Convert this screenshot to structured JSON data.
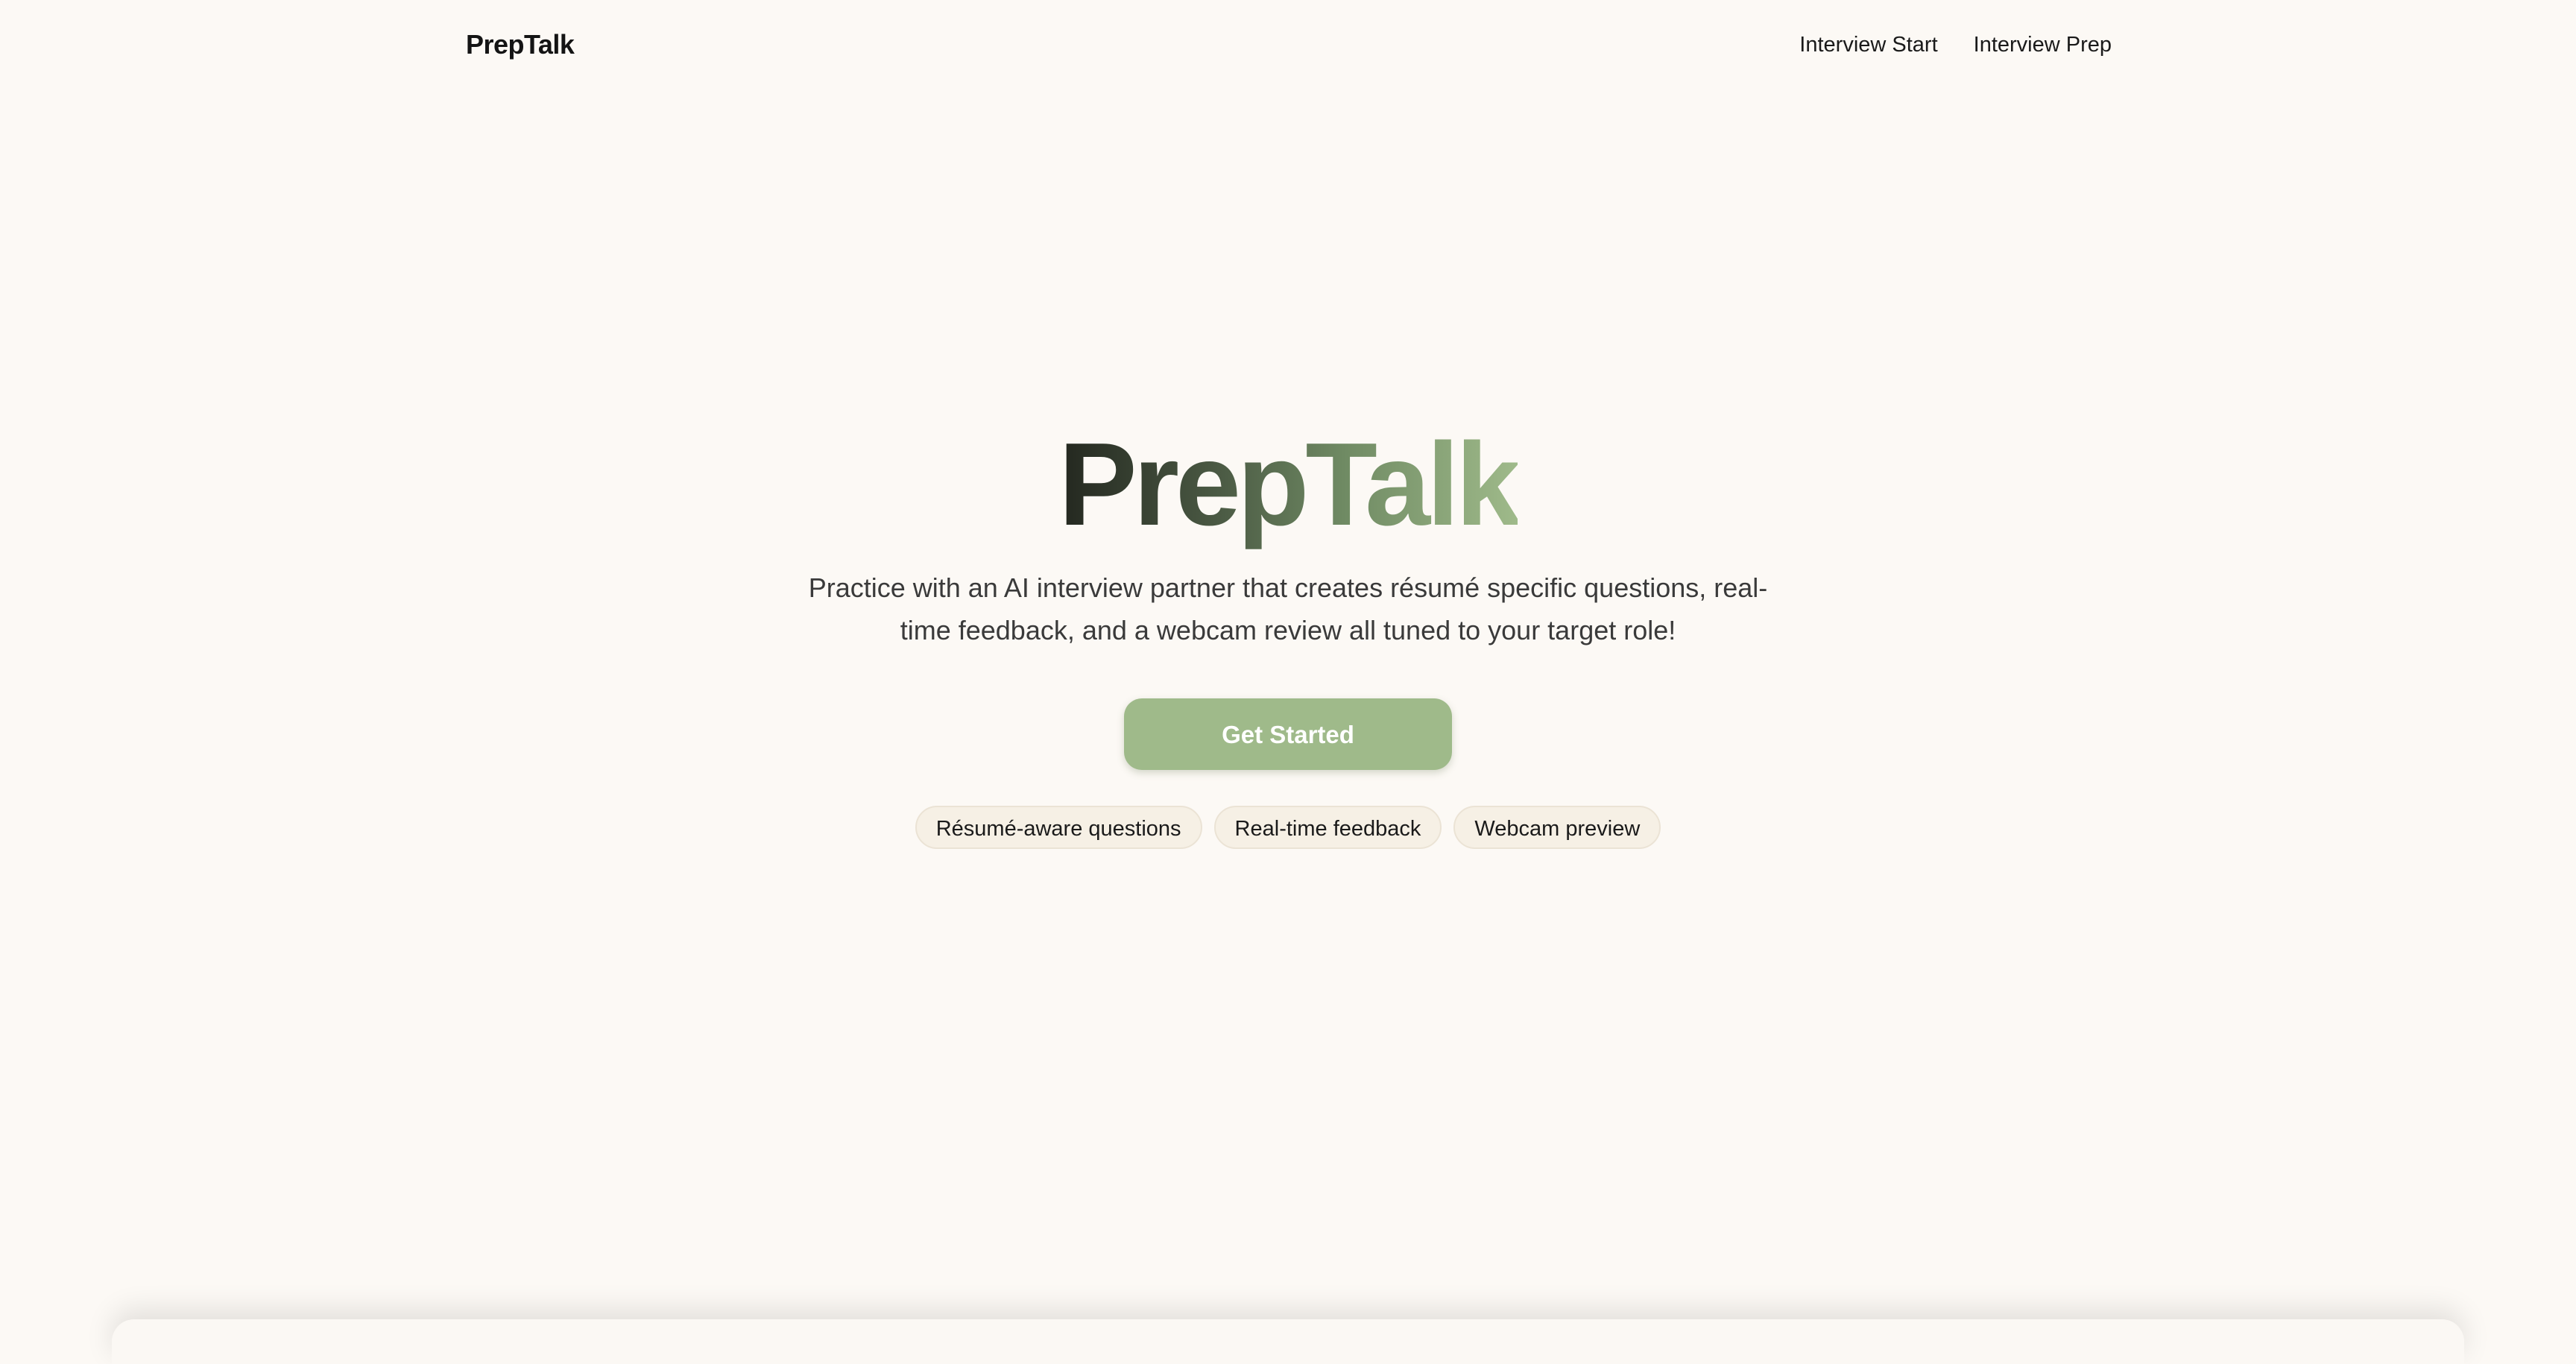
{
  "header": {
    "brand": "PrepTalk",
    "nav": [
      {
        "label": "Interview Start"
      },
      {
        "label": "Interview Prep"
      }
    ]
  },
  "hero": {
    "title": "PrepTalk",
    "subtitle": "Practice with an AI interview partner that creates résumé specific questions, real-time feedback, and a webcam review all tuned to your target role!",
    "cta_label": "Get Started",
    "features": [
      {
        "label": "Résumé-aware questions"
      },
      {
        "label": "Real-time feedback"
      },
      {
        "label": "Webcam preview"
      }
    ]
  },
  "colors": {
    "background": "#fcf9f5",
    "accent": "#9fba8a",
    "title_gradient_start": "#23271f",
    "title_gradient_end": "#9fba8a",
    "pill_background": "#f6f0e5"
  }
}
